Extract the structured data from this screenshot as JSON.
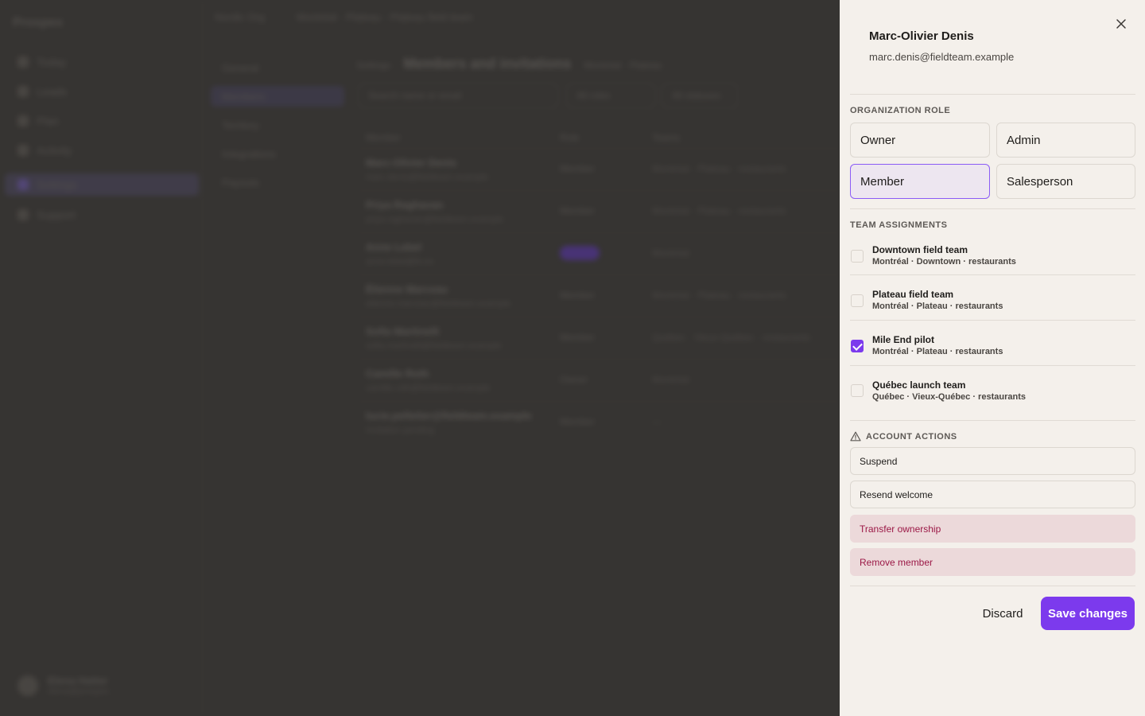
{
  "app": {
    "brand": "Prospex",
    "nav": [
      {
        "label": "Today"
      },
      {
        "label": "Leads"
      },
      {
        "label": "Plan"
      },
      {
        "label": "Activity"
      },
      {
        "label": "Settings"
      },
      {
        "label": "Support"
      }
    ],
    "user": {
      "name": "Elena Hatter",
      "email": "elena@prospex"
    },
    "topbar": [
      "Nordic Org",
      "Montréal · Plateau · Plateau field team"
    ],
    "subnav": [
      {
        "label": "General"
      },
      {
        "label": "Members"
      },
      {
        "label": "Territory"
      },
      {
        "label": "Integrations"
      },
      {
        "label": "Payouts"
      }
    ],
    "breadcrumb": "Settings",
    "page_title": "Members and invitations",
    "page_context": "Montréal · Plateau",
    "filters": {
      "search_placeholder": "Search name or email",
      "roles": "All roles",
      "teams": "All statuses"
    },
    "table": {
      "headers": [
        "Member",
        "Role",
        "Teams"
      ],
      "rows": [
        {
          "name": "Marc-Olivier Denis",
          "email": "marc.denis@fieldteam.example",
          "role": "Member",
          "teams": "Montréal · Plateau · restaurants"
        },
        {
          "name": "Priya Raghavan",
          "email": "priya.raghavan@fieldteam.example",
          "role": "Member",
          "teams": "Montréal · Plateau · restaurants"
        },
        {
          "name": "Anne Lebel",
          "email": "anne.lebel@fe.ex",
          "role": "",
          "teams": "Montréal"
        },
        {
          "name": "Étienne Marceau",
          "email": "etienne.marceau@fieldteam.example",
          "role": "Member",
          "teams": "Montréal · Plateau · restaurants"
        },
        {
          "name": "Sofia Martinelli",
          "email": "sofia.martinelli@fieldteam.example",
          "role": "Member",
          "teams": "Québec · Vieux-Québec · restaurants"
        },
        {
          "name": "Camille Roth",
          "email": "camille.roth@fieldteam.example",
          "role": "Owner",
          "teams": "Montréal"
        },
        {
          "name": "lucie.pelletier@fieldteam.example",
          "email": "Invitation pending",
          "role": "Member",
          "teams": "—"
        }
      ]
    }
  },
  "drawer": {
    "close_icon": "close-icon",
    "member": {
      "name": "Marc-Olivier Denis",
      "email": "marc.denis@fieldteam.example"
    },
    "role_section": "Organization role",
    "roles": [
      {
        "label": "Owner",
        "selected": false
      },
      {
        "label": "Admin",
        "selected": false
      },
      {
        "label": "Member",
        "selected": true
      },
      {
        "label": "Salesperson",
        "selected": false
      }
    ],
    "teams_section": "Team assignments",
    "teams": [
      {
        "name": "Downtown field team",
        "location": "Montréal · Downtown · restaurants",
        "checked": false
      },
      {
        "name": "Plateau field team",
        "location": "Montréal · Plateau · restaurants",
        "checked": false
      },
      {
        "name": "Mile End pilot",
        "location": "Montréal · Plateau · restaurants",
        "checked": true
      },
      {
        "name": "Québec launch team",
        "location": "Québec · Vieux-Québec · restaurants",
        "checked": false
      }
    ],
    "actions_section": "Account actions",
    "actions_icon": "warning-icon",
    "actions": [
      {
        "label": "Suspend",
        "danger": false
      },
      {
        "label": "Resend welcome",
        "danger": false
      },
      {
        "label": "Transfer ownership",
        "danger": true
      },
      {
        "label": "Remove member",
        "danger": true
      }
    ],
    "discard_label": "Discard",
    "save_label": "Save changes",
    "accent": "#7c3aed",
    "danger_color": "#9b1846"
  }
}
